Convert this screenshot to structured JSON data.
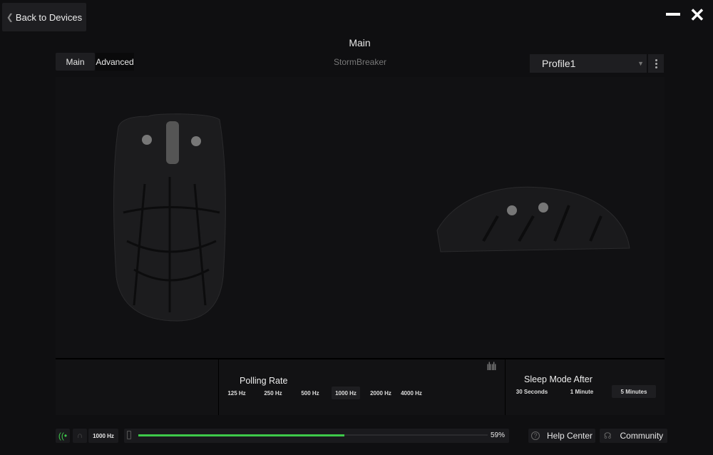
{
  "header": {
    "back_label": "Back to Devices",
    "title": "Main",
    "device_name": "StormBreaker"
  },
  "tabs": [
    {
      "label": "Main",
      "active": true
    },
    {
      "label": "Advanced",
      "active": false
    }
  ],
  "profile": {
    "selected": "Profile1"
  },
  "polling_rate": {
    "label": "Polling Rate",
    "options": [
      "125 Hz",
      "250 Hz",
      "500 Hz",
      "1000 Hz",
      "2000 Hz",
      "4000 Hz"
    ],
    "selected": "1000 Hz"
  },
  "sleep_mode": {
    "label": "Sleep Mode After",
    "options": [
      "30 Seconds",
      "1 Minute",
      "5 Minutes"
    ],
    "selected": "5 Minutes"
  },
  "status": {
    "polling": "1000 Hz",
    "battery_percent": 59,
    "battery_label": "59%",
    "connection": "wireless",
    "accent": "#3ec94a"
  },
  "footer": {
    "help": "Help Center",
    "community": "Community"
  }
}
